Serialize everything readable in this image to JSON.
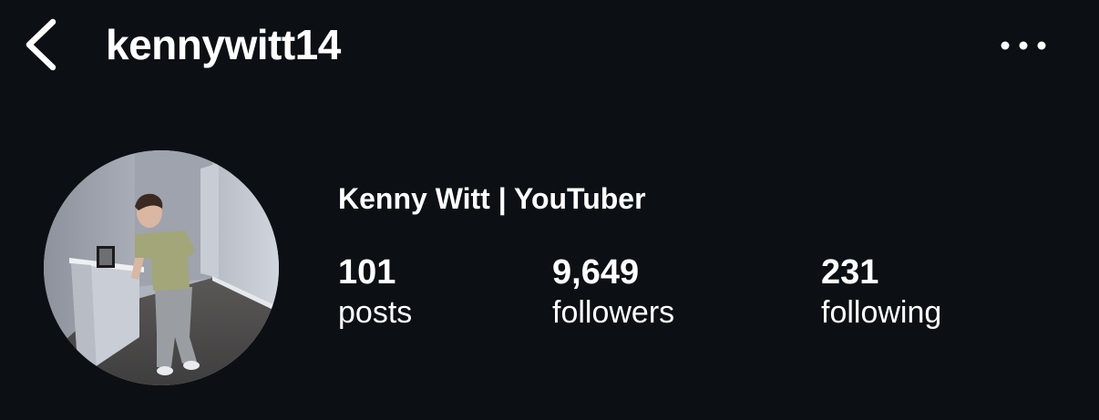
{
  "header": {
    "back_icon": "chevron-left-icon",
    "username": "kennywitt14",
    "more_icon": "more-horizontal-icon"
  },
  "profile": {
    "avatar_icon": "profile-photo",
    "display_name": "Kenny Witt | YouTuber",
    "stats": {
      "posts": {
        "value": "101",
        "label": "posts"
      },
      "followers": {
        "value": "9,649",
        "label": "followers"
      },
      "following": {
        "value": "231",
        "label": "following"
      }
    }
  },
  "colors": {
    "background": "#0c0f14",
    "text": "#ffffff"
  }
}
